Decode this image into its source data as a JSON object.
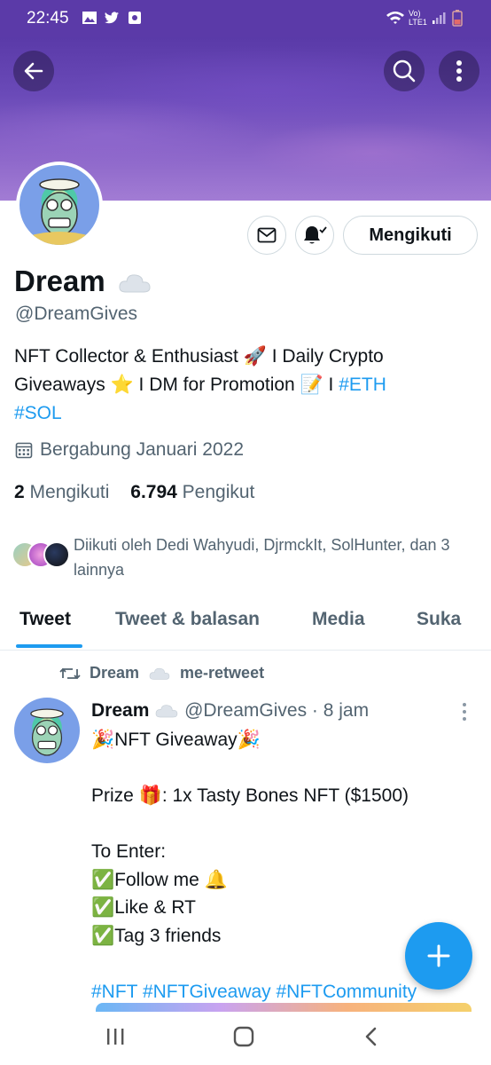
{
  "status_bar": {
    "time": "22:45",
    "network": "Vo) LTE1"
  },
  "header": {
    "back_icon": "arrow-left-icon",
    "search_icon": "search-icon",
    "more_icon": "more-vertical-icon"
  },
  "profile": {
    "name": "Dream",
    "handle": "@DreamGives",
    "bio_parts": {
      "p1": "NFT Collector & Enthusiast 🚀 I Daily Crypto Giveaways ⭐ I DM for Promotion 📝 I ",
      "eth": "#ETH",
      "sol": "#SOL"
    },
    "joined": "Bergabung Januari 2022",
    "following_count": "2",
    "following_label": "Mengikuti",
    "followers_count": "6.794",
    "followers_label": "Pengikut",
    "followed_by": "Diikuti oleh Dedi Wahyudi, DjrmckIt, SolHunter, dan 3 lainnya",
    "follow_button": "Mengikuti"
  },
  "tabs": [
    {
      "label": "Tweet",
      "active": true
    },
    {
      "label": "Tweet & balasan",
      "active": false
    },
    {
      "label": "Media",
      "active": false
    },
    {
      "label": "Suka",
      "active": false
    }
  ],
  "tweet": {
    "retweet_name": "Dream",
    "retweet_suffix": "me-retweet",
    "author_name": "Dream",
    "author_handle": "@DreamGives",
    "time": "· 8 jam",
    "body": "🎉NFT Giveaway🎉\n\nPrize 🎁: 1x Tasty Bones NFT ($1500)\n\nTo Enter:\n✅Follow me 🔔\n✅Like & RT\n✅Tag 3 friends\n\n",
    "hashtags": "#NFT #NFTGiveaway #NFTCommunity"
  },
  "colors": {
    "accent": "#1d9bf0",
    "banner": "#6a4ab8",
    "muted": "#536471"
  }
}
